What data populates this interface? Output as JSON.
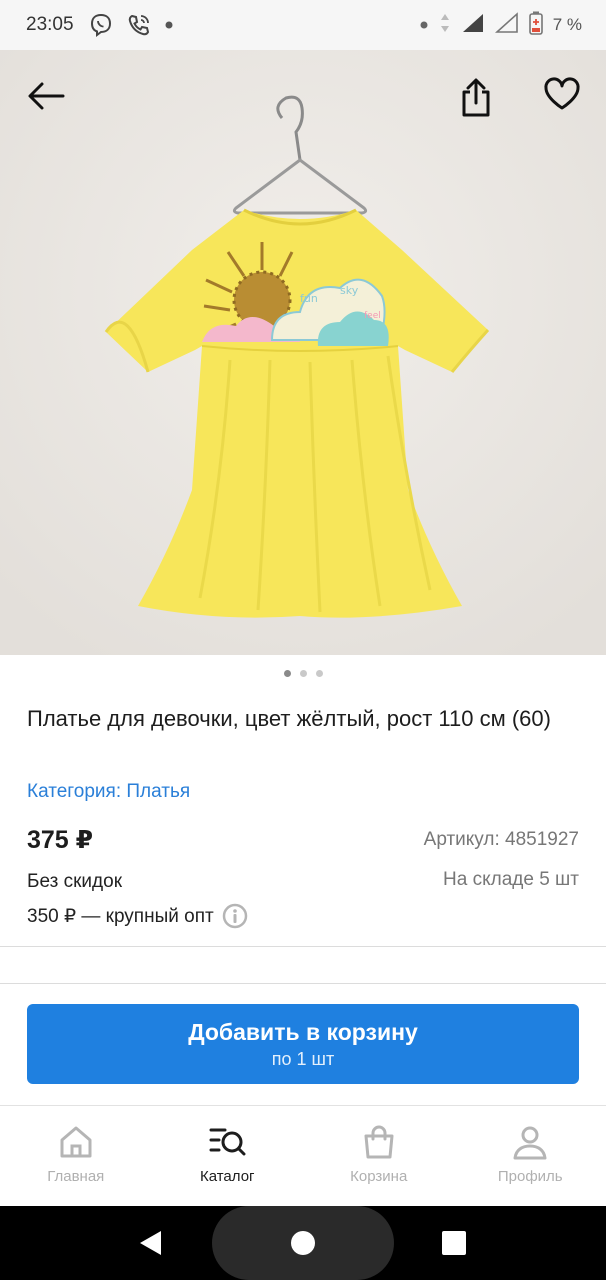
{
  "status_bar": {
    "time": "23:05",
    "left_icons": [
      "viber-icon",
      "phone-call-icon",
      "dot-icon"
    ],
    "battery": "7 %"
  },
  "product": {
    "image_dots": {
      "count": 3,
      "active": 0
    },
    "title": "Платье для девочки, цвет жёлтый, рост 110 см (60)",
    "category": "Категория: Платья",
    "price": "375 ₽",
    "sku": "Артикул: 4851927",
    "discount": "Без скидок",
    "stock": "На складе 5 шт",
    "wholesale": "350 ₽ — крупный опт"
  },
  "cart_button": {
    "label": "Добавить в корзину",
    "sublabel": "по 1 шт"
  },
  "bottom_nav": {
    "items": [
      {
        "label": "Главная",
        "icon": "home-icon",
        "active": false
      },
      {
        "label": "Каталог",
        "icon": "catalog-search-icon",
        "active": true
      },
      {
        "label": "Корзина",
        "icon": "bag-icon",
        "active": false
      },
      {
        "label": "Профиль",
        "icon": "profile-icon",
        "active": false
      }
    ]
  },
  "colors": {
    "accent": "#1f80e0",
    "link": "#2a7fd8",
    "dress": "#f7e65a",
    "photo_background": "#eae7e3"
  }
}
